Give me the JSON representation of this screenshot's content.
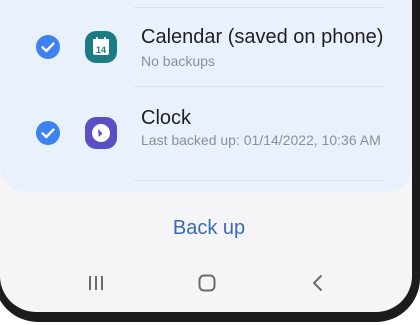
{
  "backup_list": {
    "items": [
      {
        "title": "Calendar (saved on phone)",
        "subtitle": "No backups",
        "checked": true,
        "icon": "calendar-icon",
        "icon_color": "#1a7d83",
        "icon_text": "14"
      },
      {
        "title": "Clock",
        "subtitle": "Last backed up: 01/14/2022, 10:36 AM",
        "checked": true,
        "icon": "clock-icon",
        "icon_color": "#5b4fc6"
      }
    ]
  },
  "actions": {
    "backup_label": "Back up"
  },
  "navigation": {
    "buttons": [
      "recents-icon",
      "home-icon",
      "back-icon"
    ]
  },
  "colors": {
    "accent": "#3e82f0",
    "link": "#3b6ab4",
    "card_bg": "#e9f2fc"
  }
}
